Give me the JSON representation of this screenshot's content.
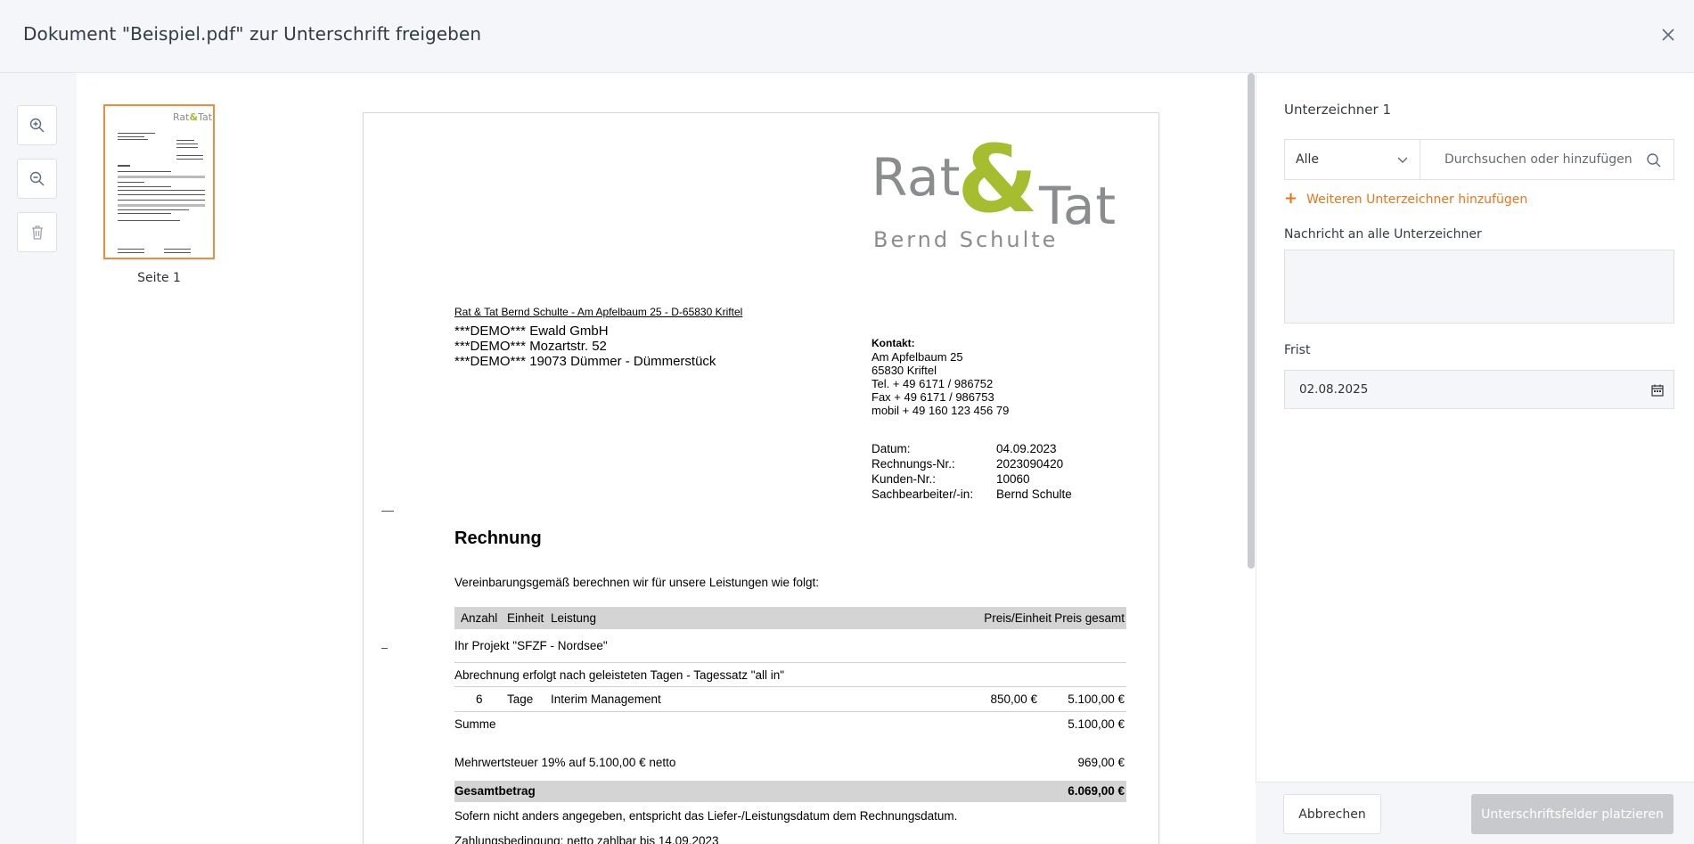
{
  "header": {
    "title": "Dokument \"Beispiel.pdf\" zur Unterschrift freigeben"
  },
  "toolbar": {
    "icons": [
      "zoom-in-icon",
      "zoom-out-icon",
      "trash-icon"
    ]
  },
  "thumbnails": [
    {
      "label": "Seite 1"
    }
  ],
  "document": {
    "logo": {
      "rat": "Rat",
      "amp": "&",
      "tat": "Tat",
      "sub": "Bernd Schulte"
    },
    "sender_line": "Rat & Tat Bernd Schulte - Am Apfelbaum 25 - D-65830 Kriftel",
    "recipient": [
      "***DEMO*** Ewald GmbH",
      "***DEMO*** Mozartstr. 52",
      "***DEMO*** 19073 Dümmer - Dümmerstück"
    ],
    "contact": {
      "title": "Kontakt:",
      "lines": [
        "Am Apfelbaum 25",
        "65830 Kriftel",
        "Tel. + 49 6171 / 986752",
        "Fax + 49 6171 / 986753",
        "mobil + 49 160 123 456 79"
      ]
    },
    "meta": [
      {
        "k": "Datum:",
        "v": "04.09.2023"
      },
      {
        "k": "Rechnungs-Nr.:",
        "v": "2023090420"
      },
      {
        "k": "Kunden-Nr.:",
        "v": "10060"
      },
      {
        "k": "Sachbearbeiter/-in:",
        "v": "Bernd Schulte"
      }
    ],
    "heading": "Rechnung",
    "intro": "Vereinbarungsgemäß berechnen wir für unsere Leistungen wie folgt:",
    "table_head": {
      "anzahl": "Anzahl",
      "einheit": "Einheit",
      "leistung": "Leistung",
      "preis_einheit": "Preis/Einheit",
      "preis_gesamt": "Preis gesamt"
    },
    "project": "Ihr Projekt \"SFZF - Nordsee\"",
    "billing_note": "Abrechnung erfolgt nach geleisteten Tagen - Tagessatz \"all in\"",
    "item": {
      "anzahl": "6",
      "einheit": "Tage",
      "leistung": "Interim Management",
      "preis_einheit": "850,00 €",
      "preis_gesamt": "5.100,00 €"
    },
    "summe": {
      "label": "Summe",
      "value": "5.100,00 €"
    },
    "mwst": {
      "label": "Mehrwertsteuer 19% auf 5.100,00 € netto",
      "value": "969,00 €"
    },
    "gesamt": {
      "label": "Gesamtbetrag",
      "value": "6.069,00 €"
    },
    "note1": "Sofern nicht anders angegeben, entspricht das Liefer-/Leistungsdatum dem Rechnungsdatum.",
    "note2": "Zahlungsbedingung: netto zahlbar bis 14.09.2023"
  },
  "panel": {
    "signer_title": "Unterzeichner 1",
    "select_value": "Alle",
    "search_placeholder": "Durchsuchen oder hinzufügen",
    "add_signer": "Weiteren Unterzeichner hinzufügen",
    "message_label": "Nachricht an alle Unterzeichner",
    "message_value": "",
    "deadline_label": "Frist",
    "deadline_value": "02.08.2025"
  },
  "footer": {
    "cancel": "Abbrechen",
    "place": "Unterschriftsfelder platzieren"
  },
  "colors": {
    "accent": "#e8751a",
    "logo_green": "#a6bd2f",
    "logo_gray": "#8a8c8e",
    "disabled_button": "#c7c9cc"
  }
}
